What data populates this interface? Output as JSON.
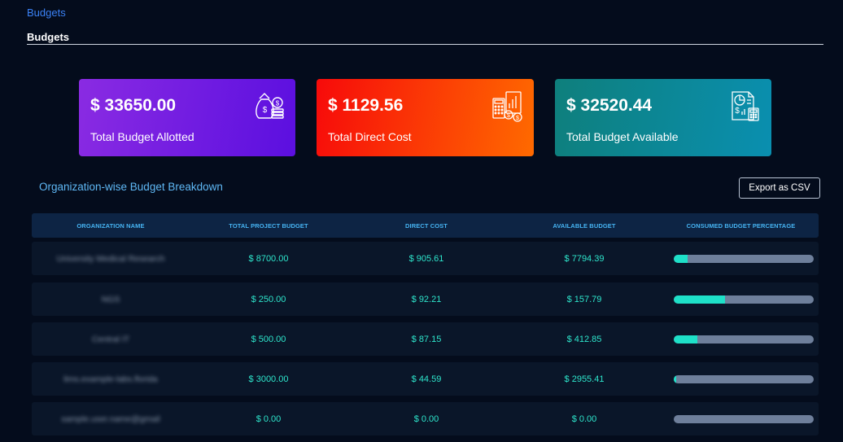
{
  "breadcrumb": "Budgets",
  "page_title": "Budgets",
  "cards": [
    {
      "value": "$ 33650.00",
      "label": "Total Budget Allotted",
      "icon": "money-bag-coins-icon"
    },
    {
      "value": "$ 1129.56",
      "label": "Total Direct Cost",
      "icon": "cost-calculator-chart-icon"
    },
    {
      "value": "$ 32520.44",
      "label": "Total Budget Available",
      "icon": "budget-report-icon"
    }
  ],
  "section_title": "Organization-wise Budget Breakdown",
  "export_label": "Export as CSV",
  "table": {
    "headers": [
      "Organization Name",
      "Total Project Budget",
      "Direct Cost",
      "Available Budget",
      "Consumed Budget Percentage"
    ],
    "rows": [
      {
        "org": "University Medical Research",
        "total": "$ 8700.00",
        "direct": "$ 905.61",
        "available": "$ 7794.39",
        "consumed_pct": 10.4
      },
      {
        "org": "NGS",
        "total": "$ 250.00",
        "direct": "$ 92.21",
        "available": "$ 157.79",
        "consumed_pct": 36.9
      },
      {
        "org": "Central IT",
        "total": "$ 500.00",
        "direct": "$ 87.15",
        "available": "$ 412.85",
        "consumed_pct": 17.4
      },
      {
        "org": "lims.example-labs.florida",
        "total": "$ 3000.00",
        "direct": "$ 44.59",
        "available": "$ 2955.41",
        "consumed_pct": 1.5
      },
      {
        "org": "sample.user.name@gmail",
        "total": "$ 0.00",
        "direct": "$ 0.00",
        "available": "$ 0.00",
        "consumed_pct": 0
      }
    ]
  },
  "colors": {
    "background": "#040c1c",
    "accent_teal": "#1ee0c8",
    "bar_track": "#6e7f9b",
    "header_text": "#46b3f2"
  }
}
